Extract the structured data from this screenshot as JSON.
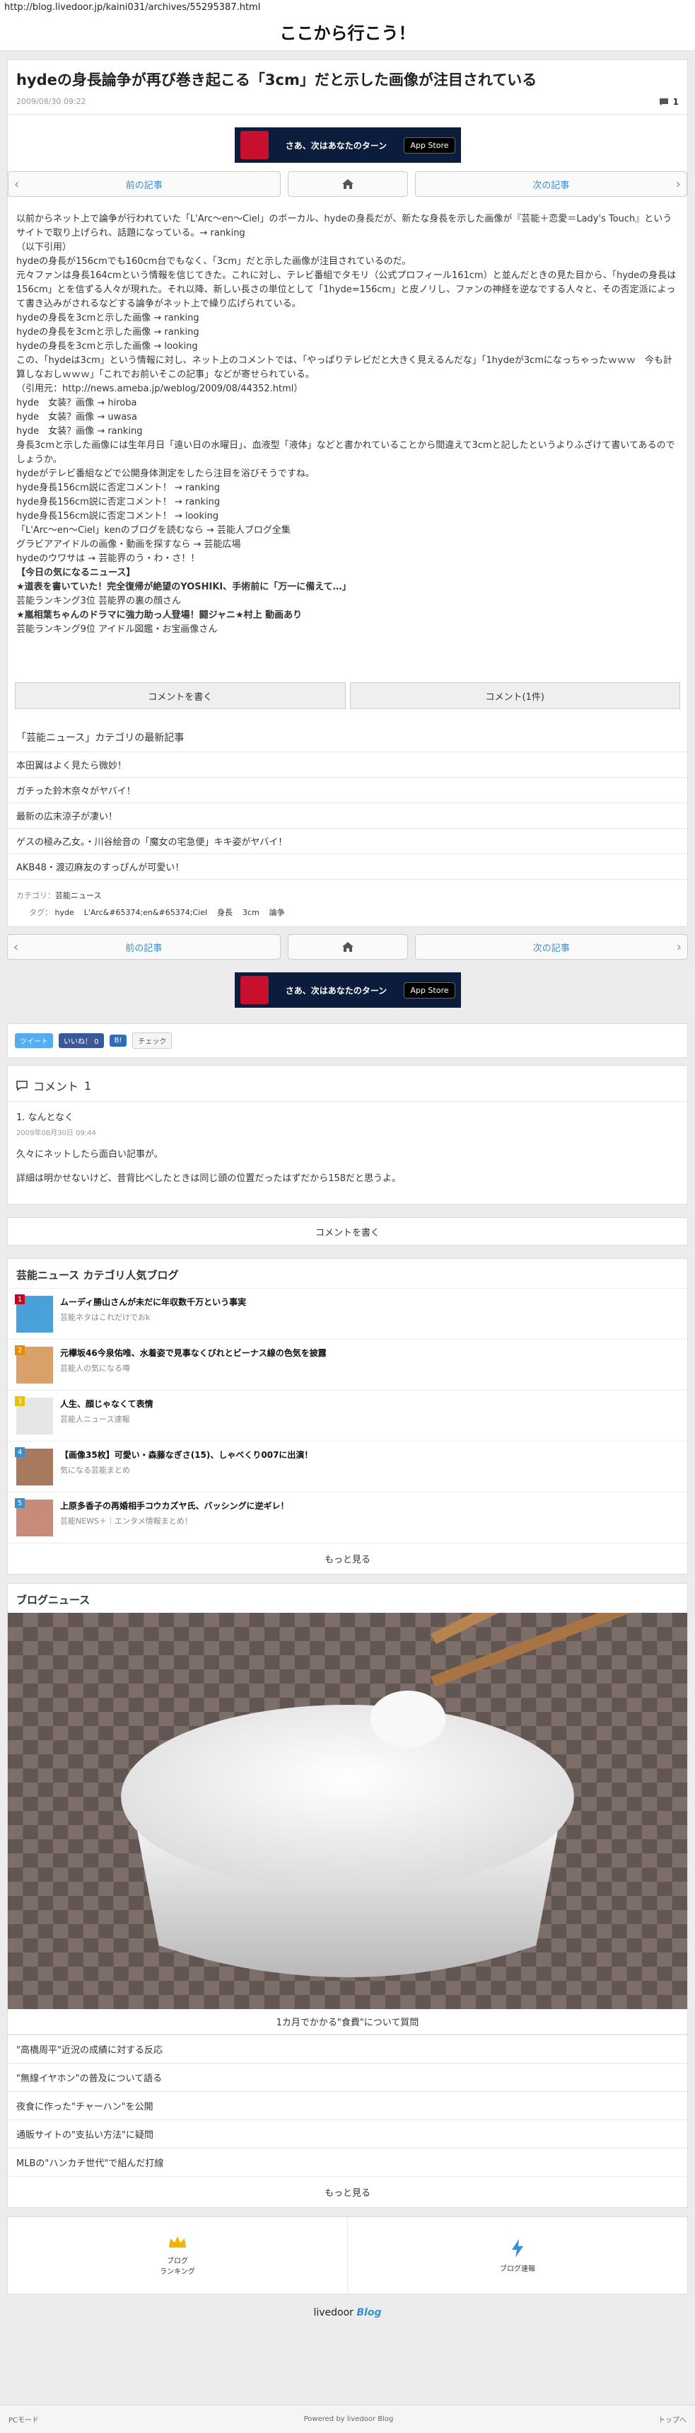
{
  "browser": {
    "url": "http://blog.livedoor.jp/kaini031/archives/55295387.html"
  },
  "site": {
    "title": "ここから行こう！"
  },
  "article": {
    "title": "hydeの身長論争が再び巻き起こる「3cm」だと示した画像が注目されている",
    "date": "2009/08/30 09:22",
    "comment_count": "1",
    "paragraphs": [
      "以前からネット上で論争が行われていた「L'Arc〜en〜Ciel」のボーカル、hydeの身長だが、新たな身長を示した画像が『芸能＋恋愛＝Lady's Touch』というサイトで取り上げられ、話題になっている。→ ranking",
      "（以下引用）",
      "hydeの身長が156cmでも160cm台でもなく、「3cm」だと示した画像が注目されているのだ。",
      "元々ファンは身長164cmという情報を信じてきた。これに対し、テレビ番組でタモリ（公式プロフィール161cm）と並んだときの見た目から、「hydeの身長は156cm」とを信ずる人々が現れた。それ以降、新しい長さの単位として「1hyde=156cm」と皮ノリし、ファンの神経を逆なでする人々と、その否定派によって書き込みがされるなどする論争がネット上で繰り広げられている。",
      "hydeの身長を3cmと示した画像 → ranking",
      "hydeの身長を3cmと示した画像 → ranking",
      "hydeの身長を3cmと示した画像 → looking",
      "この、「hydeは3cm」という情報に対し、ネット上のコメントでは、「やっぱりテレビだと大きく見えるんだな」「1hydeが3cmになっちゃったｗｗｗ　今も計算しなおしｗｗｗ」「これでお前いそこの記事」などが寄せられている。",
      "（引用元：http://news.ameba.jp/weblog/2009/08/44352.html）",
      "hyde　女装？画像 → hiroba",
      "hyde　女装？画像 → uwasa",
      "hyde　女装？画像 → ranking",
      "身長3cmと示した画像には生年月日「遠い日の水曜日」、血液型「液体」などと書かれていることから間違えて3cmと記したというよりふざけて書いてあるのでしょうか。",
      "hydeがテレビ番組などで公開身体測定をしたら注目を浴びそうですね。",
      "hyde身長156cm説に否定コメント！ → ranking",
      "hyde身長156cm説に否定コメント！ → ranking",
      "hyde身長156cm説に否定コメント！ → looking",
      "「L'Arc〜en〜Ciel」kenのブログを読むなら → 芸能人ブログ全集",
      "グラビアアイドルの画像・動画を探すなら → 芸能広場",
      "hydeのウワサは → 芸能界のう・わ・さ！！",
      "【今日の気になるニュース】",
      "★道表を書いていた！完全復帰が絶望のYOSHIKI、手術前に「万一に備えて…」",
      "芸能ランキング3位 芸能界の裏の顔さん",
      "★嵐相葉ちゃんのドラマに強力助っ人登場！闘ジャニ★村上 動画あり",
      "芸能ランキング9位 アイドル図鑑・お宝画像さん"
    ]
  },
  "banner": {
    "text": "さあ、次はあなたのターン",
    "store": "App Store"
  },
  "pager": {
    "prev": "前の記事",
    "next": "次の記事"
  },
  "comment_buttons": {
    "write": "コメントを書く",
    "count": "コメント(1件)"
  },
  "category": {
    "heading": "「芸能ニュース」カテゴリの最新記事",
    "items": [
      "本田翼はよく見たら微妙！",
      "ガチった鈴木奈々がヤバイ！",
      "最新の広末涼子が凄い！",
      "ゲスの極み乙女。・川谷絵音の「魔女の宅急便」キキ姿がヤバイ！",
      "AKB48・渡辺麻友のすっぴんが可愛い！"
    ],
    "label": "カテゴリ：",
    "name": "芸能ニュース",
    "tag_label": "タグ：",
    "tags": [
      "hyde",
      "L'Arc&#65374;en&#65374;Ciel",
      "身長",
      "3cm",
      "論争"
    ]
  },
  "share": {
    "tweet": "ツイート",
    "like": "いいね！ 0",
    "hatena": "B!",
    "check": "チェック"
  },
  "comments": {
    "heading": "コメント",
    "count": "1",
    "author": "1. なんとなく",
    "date": "2009年08月30日 09:44",
    "lines": [
      "久々にネットしたら面白い記事が。",
      "詳細は明かせないけど、昔背比べしたときは同じ頭の位置だったはずだから158だと思うよ。"
    ],
    "write": "コメントを書く"
  },
  "ranking": {
    "heading": "芸能ニュース カテゴリ人気ブログ",
    "items": [
      {
        "rank": "1",
        "title": "ムーディ勝山さんが未だに年収数千万という事実",
        "site": "芸能ネタはこれだけでおk"
      },
      {
        "rank": "2",
        "title": "元欅坂46今泉佑唯、水着姿で見事なくびれとビーナス線の色気を披露",
        "site": "芸能人の気になる噂"
      },
      {
        "rank": "3",
        "title": "人生、顔じゃなくて表情",
        "site": "芸能人ニュース速報"
      },
      {
        "rank": "4",
        "title": "【画像35枚】可愛い・森藤なぎさ(15)、しゃべくり007に出演！",
        "site": "気になる芸能まとめ"
      },
      {
        "rank": "5",
        "title": "上原多香子の再婚相手コウカズヤ氏、バッシングに逆ギレ！",
        "site": "芸能NEWS＋｜エンタメ情報まとめ！"
      }
    ],
    "more": "もっと見る"
  },
  "blog_news": {
    "heading": "ブログニュース",
    "caption": "1カ月でかかる\"食費\"について質問",
    "items": [
      "\"高橋周平\"近況の成績に対する反応",
      "\"無線イヤホン\"の普及について語る",
      "夜食に作った\"チャーハン\"を公開",
      "通販サイトの\"支払い方法\"に疑問",
      "MLBの\"ハンカチ世代\"で組んだ打線"
    ],
    "more": "もっと見る"
  },
  "footer": {
    "ranking_label": "ブログ\nランキング",
    "news_label": "ブログ速報",
    "logo": "livedoor",
    "logo2": "Blog",
    "pc_mode": "PCモード",
    "powered": "Powered by livedoor Blog",
    "top": "トップへ"
  },
  "colors": {
    "accent": "#3a8fd0",
    "red": "#d0021b",
    "twitter": "#55acee",
    "facebook": "#3b5998"
  }
}
